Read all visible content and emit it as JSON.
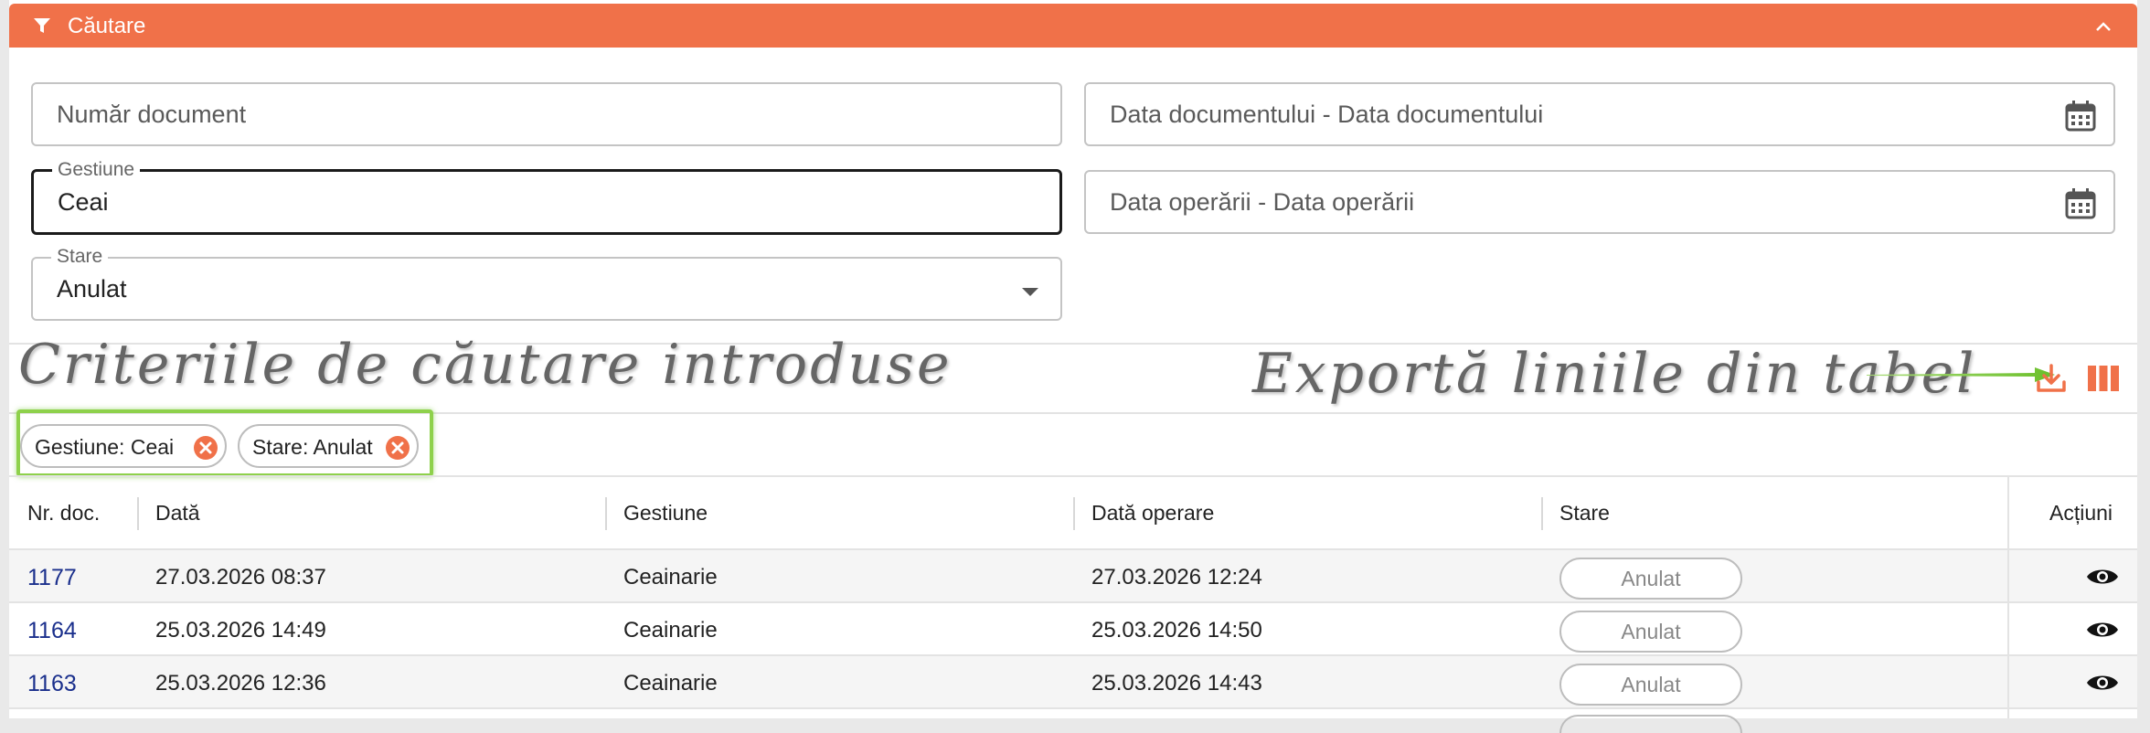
{
  "header": {
    "title": "Căutare",
    "funnel_icon": "filter-icon",
    "collapse_icon": "chevron-up-icon",
    "color": "#f07149"
  },
  "filters": {
    "numar_document": {
      "placeholder": "Număr document"
    },
    "data_documentului": {
      "placeholder": "Data documentului - Data documentului"
    },
    "gestiune": {
      "label": "Gestiune",
      "value": "Ceai"
    },
    "data_operarii": {
      "placeholder": "Data operării - Data operării"
    },
    "stare": {
      "label": "Stare",
      "value": "Anulat"
    }
  },
  "annotations": {
    "criteria": "Criteriile de căutare introduse",
    "export": "Exportă liniile din tabel"
  },
  "toolbar": {
    "export_icon": "download-icon",
    "columns_icon": "columns-icon",
    "accent": "#f07149"
  },
  "chips": [
    {
      "label": "Gestiune: Ceai"
    },
    {
      "label": "Stare: Anulat"
    }
  ],
  "table": {
    "headers": [
      "Nr. doc.",
      "Dată",
      "Gestiune",
      "Dată operare",
      "Stare",
      "Acțiuni"
    ],
    "rows": [
      {
        "nr": "1177",
        "data": "27.03.2026 08:37",
        "gestiune": "Ceainarie",
        "data_operare": "27.03.2026 12:24",
        "stare": "Anulat"
      },
      {
        "nr": "1164",
        "data": "25.03.2026 14:49",
        "gestiune": "Ceainarie",
        "data_operare": "25.03.2026 14:50",
        "stare": "Anulat"
      },
      {
        "nr": "1163",
        "data": "25.03.2026 12:36",
        "gestiune": "Ceainarie",
        "data_operare": "25.03.2026 14:43",
        "stare": "Anulat"
      }
    ]
  }
}
